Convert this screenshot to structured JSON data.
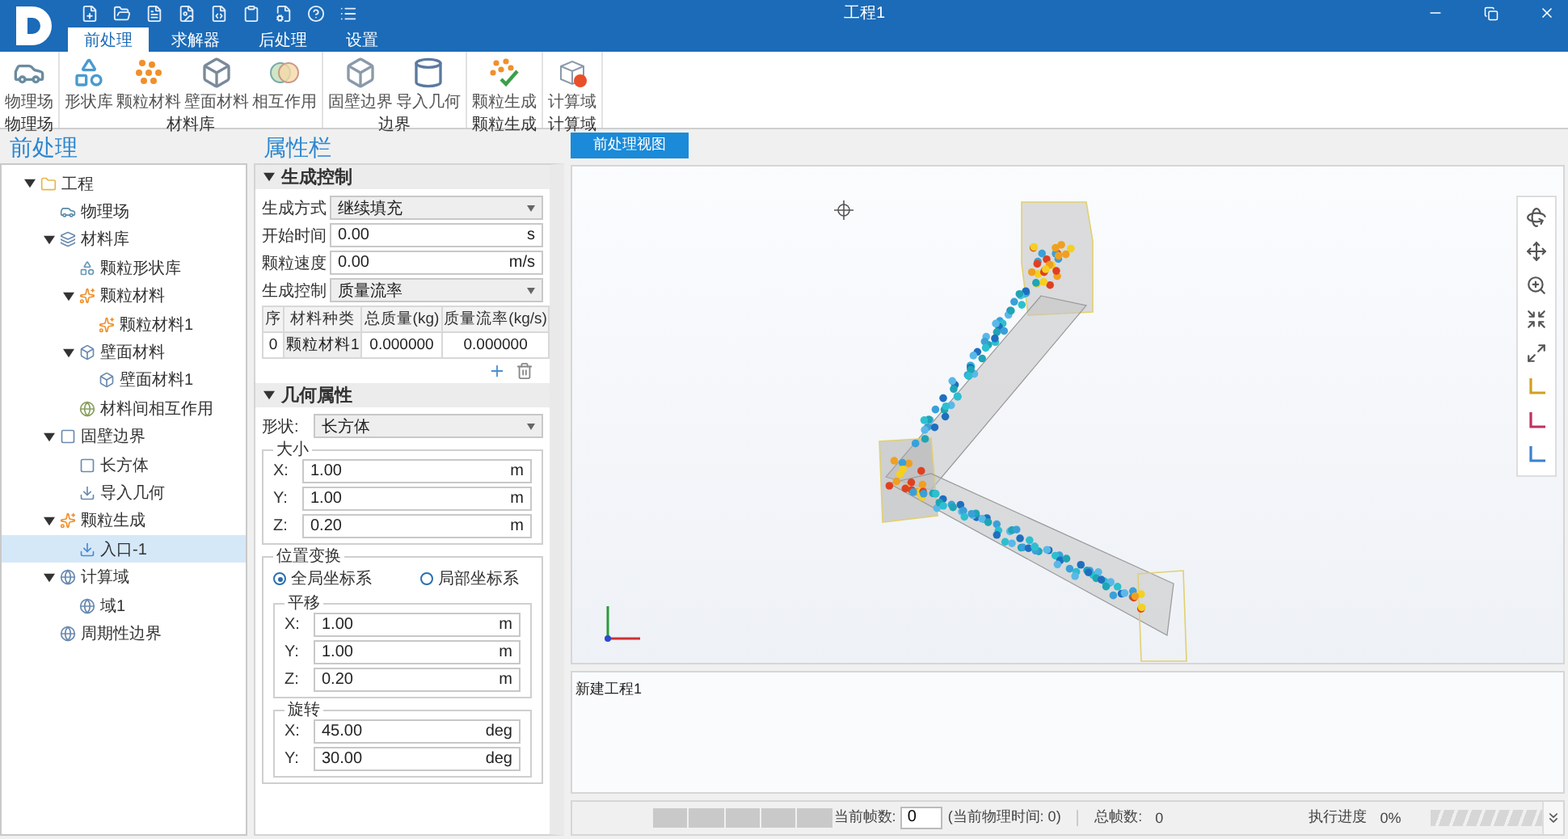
{
  "window": {
    "title": "工程1"
  },
  "tabs": [
    {
      "label": "前处理",
      "selected": true
    },
    {
      "label": "求解器",
      "selected": false
    },
    {
      "label": "后处理",
      "selected": false
    },
    {
      "label": "设置",
      "selected": false
    }
  ],
  "ribbon": [
    {
      "label": "物理场",
      "items": [
        "物理场"
      ]
    },
    {
      "label": "材料库",
      "items": [
        "形状库",
        "颗粒材料",
        "壁面材料",
        "相互作用"
      ]
    },
    {
      "label": "边界",
      "items": [
        "固壁边界",
        "导入几何"
      ]
    },
    {
      "label": "颗粒生成",
      "items": [
        "颗粒生成"
      ]
    },
    {
      "label": "计算域",
      "items": [
        "计算域"
      ]
    }
  ],
  "tree_panel": {
    "title": "前处理",
    "nodes": [
      {
        "label": "工程",
        "selected": false,
        "expanded": true,
        "children": [
          {
            "label": "物理场",
            "selected": false
          },
          {
            "label": "材料库",
            "selected": false,
            "expanded": true,
            "children": [
              {
                "label": "颗粒形状库",
                "selected": false
              },
              {
                "label": "颗粒材料",
                "selected": false,
                "expanded": true,
                "children": [
                  {
                    "label": "颗粒材料1",
                    "selected": false
                  }
                ]
              },
              {
                "label": "壁面材料",
                "selected": false,
                "expanded": true,
                "children": [
                  {
                    "label": "壁面材料1",
                    "selected": false
                  }
                ]
              },
              {
                "label": "材料间相互作用",
                "selected": false
              }
            ]
          },
          {
            "label": "固壁边界",
            "selected": false,
            "expanded": true,
            "children": [
              {
                "label": "长方体",
                "selected": false
              },
              {
                "label": "导入几何",
                "selected": false
              }
            ]
          },
          {
            "label": "颗粒生成",
            "selected": false,
            "expanded": true,
            "children": [
              {
                "label": "入口-1",
                "selected": true
              }
            ]
          },
          {
            "label": "计算域",
            "selected": false,
            "expanded": true,
            "children": [
              {
                "label": "域1",
                "selected": false
              }
            ]
          },
          {
            "label": "周期性边界",
            "selected": false
          }
        ]
      }
    ]
  },
  "properties": {
    "title": "属性栏",
    "generation": {
      "title": "生成控制",
      "expanded": true,
      "fields": [
        {
          "kind": "select",
          "label": "生成方式",
          "value": "继续填充"
        },
        {
          "kind": "input",
          "label": "开始时间",
          "value": "0.00",
          "unit": "s"
        },
        {
          "kind": "input",
          "label": "颗粒速度",
          "value": "0.00",
          "unit": "m/s"
        },
        {
          "kind": "select",
          "label": "生成控制",
          "value": "质量流率"
        }
      ],
      "table": {
        "columns": [
          "序",
          "材料种类",
          "总质量(kg)",
          "质量流率(kg/s)"
        ],
        "rows": [
          [
            "0",
            "颗粒材料1",
            "0.000000",
            "0.000000"
          ]
        ]
      }
    },
    "geometry": {
      "title": "几何属性",
      "expanded": true,
      "shape": {
        "label": "形状:",
        "value": "长方体"
      },
      "size": {
        "title": "大小",
        "fields": [
          {
            "label": "X:",
            "value": "1.00",
            "unit": "m"
          },
          {
            "label": "Y:",
            "value": "1.00",
            "unit": "m"
          },
          {
            "label": "Z:",
            "value": "0.20",
            "unit": "m"
          }
        ]
      },
      "transform": {
        "title": "位置变换",
        "options": [
          {
            "label": "全局坐标系",
            "selected": true
          },
          {
            "label": "局部坐标系",
            "selected": false
          }
        ],
        "translation": {
          "title": "平移",
          "fields": [
            {
              "label": "X:",
              "value": "1.00",
              "unit": "m"
            },
            {
              "label": "Y:",
              "value": "1.00",
              "unit": "m"
            },
            {
              "label": "Z:",
              "value": "0.20",
              "unit": "m"
            }
          ]
        },
        "rotation": {
          "title": "旋转",
          "fields": [
            {
              "label": "X:",
              "value": "45.00",
              "unit": "deg"
            },
            {
              "label": "Y:",
              "value": "30.00",
              "unit": "deg"
            }
          ]
        }
      }
    }
  },
  "viewport": {
    "tabs": [
      {
        "label": "前处理视图",
        "selected": true
      }
    ]
  },
  "log": {
    "lines": [
      "新建工程1"
    ]
  },
  "status_bar": {
    "frame_label": "当前帧数:",
    "frame_value": "0",
    "time_text": "(当前物理时间: 0)",
    "total_label": "总帧数:",
    "total_value": "0",
    "progress_label": "执行进度",
    "progress_text": "0%",
    "level": 0
  }
}
